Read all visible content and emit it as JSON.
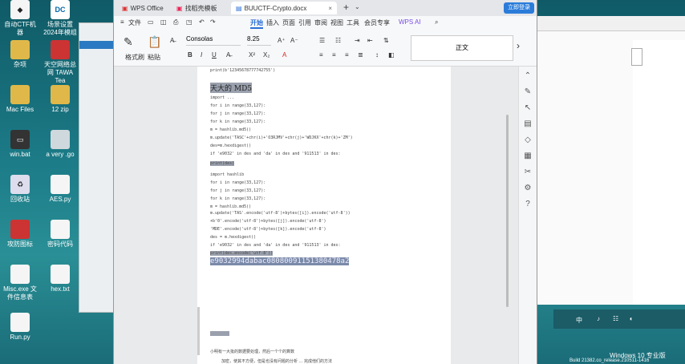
{
  "desktop": {
    "icons": [
      {
        "label": "自动CTF机器"
      },
      {
        "label": "场景设置\n2024年模组"
      },
      {
        "label": "杂项"
      },
      {
        "label": "天空网络总网\nTAWA Tea"
      },
      {
        "label": "Mac Files"
      },
      {
        "label": "12 zip"
      },
      {
        "label": "win.bat"
      },
      {
        "label": "a very .go"
      },
      {
        "label": "回收站"
      },
      {
        "label": "AES.py"
      },
      {
        "label": "攻防图标"
      },
      {
        "label": "密码代码"
      },
      {
        "label": "Misc.exe\n文件信息表"
      },
      {
        "label": "hex.txt"
      },
      {
        "label": "Run.py"
      }
    ],
    "os_label": "Windows 10 专业版",
    "build_label": "Build 21382.co_release.210511-1416",
    "taskbar_lang": "中"
  },
  "window": {
    "tabs": [
      {
        "label": "WPS Office"
      },
      {
        "label": "找稻壳模板"
      },
      {
        "label": "BUUCTF-Crypto.docx"
      }
    ],
    "new_tab": "+",
    "login_label": "立即登录"
  },
  "menu": {
    "file": "文件",
    "items": [
      "开始",
      "插入",
      "页面",
      "引用",
      "审阅",
      "视图",
      "工具",
      "会员专享"
    ],
    "ai": "WPS AI"
  },
  "toolbar": {
    "format_painter": "格式刷",
    "paste": "粘贴",
    "font": "Consolas",
    "size": "8.25",
    "style_preview": "正文",
    "bold": "B",
    "italic": "I",
    "underline": "U"
  },
  "document": {
    "lines": [
      "print(b'12345678777742755')",
      "天大的 MD5",
      "import ...",
      "for i in range(33,127):",
      "  for j in range(33,127):",
      "    for k in range(33,127):",
      "      m = hashlib.md5()",
      "      m.update('TASC'+chr(i)+'O3RJMV'+chr(j)+'WDJKX'+chr(k)+'ZM')",
      "      des=m.hexdigest()",
      "      if 'e9032' in des and 'da' in des and '911513' in des:",
      "        print(des)",
      "import hashlib",
      "for i in range(33,127):",
      "  for j in range(33,127):",
      "    for k in range(33,127):",
      "      m = hashlib.md5()",
      "      m.update('TAS'.encode('utf-8')+bytes([i]).encode('utf-8'))",
      "      +b'0'.encode('utf-8')+bytes([j]).encode('utf-8')",
      "      'MDE'.encode('utf-8')+bytes([k]).encode('utf-8')",
      "      des = m.hexdigest()",
      "      if 'e9032' in des and 'da' in des and '911513' in des:",
      "        print(des.encode('utf-8'))",
      "e9032994dabac08080091151380478a2",
      "........",
      "小明有一大批的数据要处理，然后一个个的算数",
      "    加密，使其不方便，但是也没有问题的分析 ... 完成他们的方法"
    ]
  }
}
